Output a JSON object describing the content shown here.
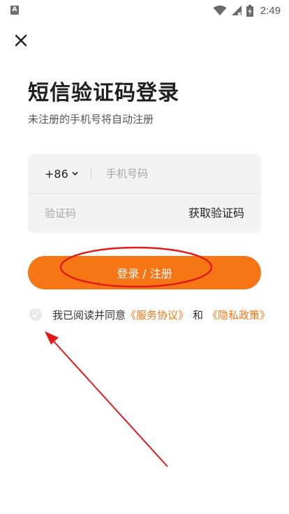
{
  "status_bar": {
    "left_icon": "A",
    "time": "2:49",
    "icons": [
      "wifi-icon",
      "signal-icon",
      "battery-icon"
    ]
  },
  "page": {
    "title": "短信验证码登录",
    "subtitle": "未注册的手机号将自动注册"
  },
  "form": {
    "country_code": "+86",
    "phone_placeholder": "手机号码",
    "code_placeholder": "验证码",
    "get_code_label": "获取验证码"
  },
  "login_button_label": "登录 / 注册",
  "agreement": {
    "prefix": "我已阅读并同意",
    "service_link": "《服务协议》",
    "and": "和",
    "privacy_link": "《隐私政策》",
    "checked": false
  },
  "colors": {
    "accent": "#f67616",
    "annotation": "#e11a1a"
  }
}
